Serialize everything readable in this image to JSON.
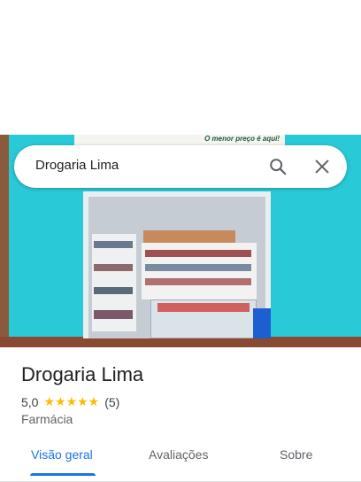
{
  "search": {
    "query": "Drogaria Lima"
  },
  "photo": {
    "sign_text": "O menor preço é aqui!"
  },
  "place": {
    "title": "Drogaria Lima",
    "rating": "5,0",
    "stars": "★★★★★",
    "review_count": "(5)",
    "category": "Farmácia"
  },
  "tabs": [
    {
      "label": "Visão geral"
    },
    {
      "label": "Avaliações"
    },
    {
      "label": "Sobre"
    }
  ],
  "colors": {
    "accent": "#1a73e8",
    "star": "#fbbc04",
    "wall": "#29c9d8"
  },
  "icons": {
    "search": "search-icon",
    "close": "close-icon"
  }
}
